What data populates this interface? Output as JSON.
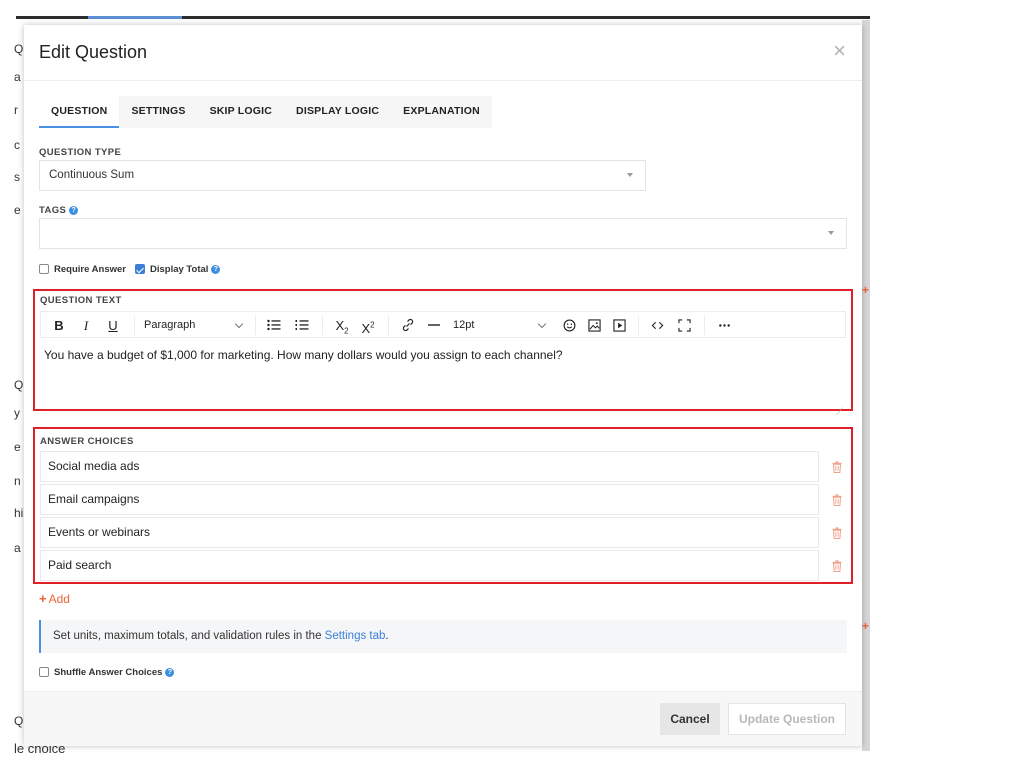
{
  "background": {
    "left_letters": [
      "Q",
      "a",
      "r",
      "c",
      "s",
      "e",
      "Q",
      "y",
      "e",
      "n",
      "hi",
      "a",
      "Q"
    ],
    "bottom_text": "le choice",
    "marker": "+"
  },
  "modal": {
    "title": "Edit Question",
    "close_label": "×",
    "tabs": [
      {
        "label": "QUESTION",
        "active": true
      },
      {
        "label": "SETTINGS"
      },
      {
        "label": "SKIP LOGIC"
      },
      {
        "label": "DISPLAY LOGIC"
      },
      {
        "label": "EXPLANATION"
      }
    ]
  },
  "question_type": {
    "label": "QUESTION TYPE",
    "value": "Continuous Sum"
  },
  "tags": {
    "label": "TAGS",
    "value": ""
  },
  "options": {
    "require_answer": {
      "label": "Require Answer",
      "checked": false
    },
    "display_total": {
      "label": "Display Total",
      "checked": true
    }
  },
  "question_text": {
    "label": "QUESTION TEXT",
    "toolbar": {
      "bold": "B",
      "italic": "I",
      "underline": "U",
      "block_format": "Paragraph",
      "font_size": "12pt"
    },
    "content": "You have a budget of $1,000 for marketing. How many dollars would you assign to each channel?"
  },
  "answer_choices": {
    "label": "ANSWER CHOICES",
    "items": [
      {
        "text": "Social media ads"
      },
      {
        "text": "Email campaigns"
      },
      {
        "text": "Events or webinars"
      },
      {
        "text": "Paid search"
      }
    ],
    "add_label": "Add",
    "add_plus": "+"
  },
  "info": {
    "text": "Set units, maximum totals, and validation rules in the ",
    "link": "Settings tab",
    "suffix": "."
  },
  "shuffle": {
    "label": "Shuffle Answer Choices",
    "checked": false
  },
  "footer": {
    "cancel_label": "Cancel",
    "update_label": "Update Question"
  },
  "colors": {
    "accent": "#4a90e2",
    "highlight_border": "#e01f26",
    "add_orange": "#e8643a",
    "trash": "#f0a08a"
  }
}
